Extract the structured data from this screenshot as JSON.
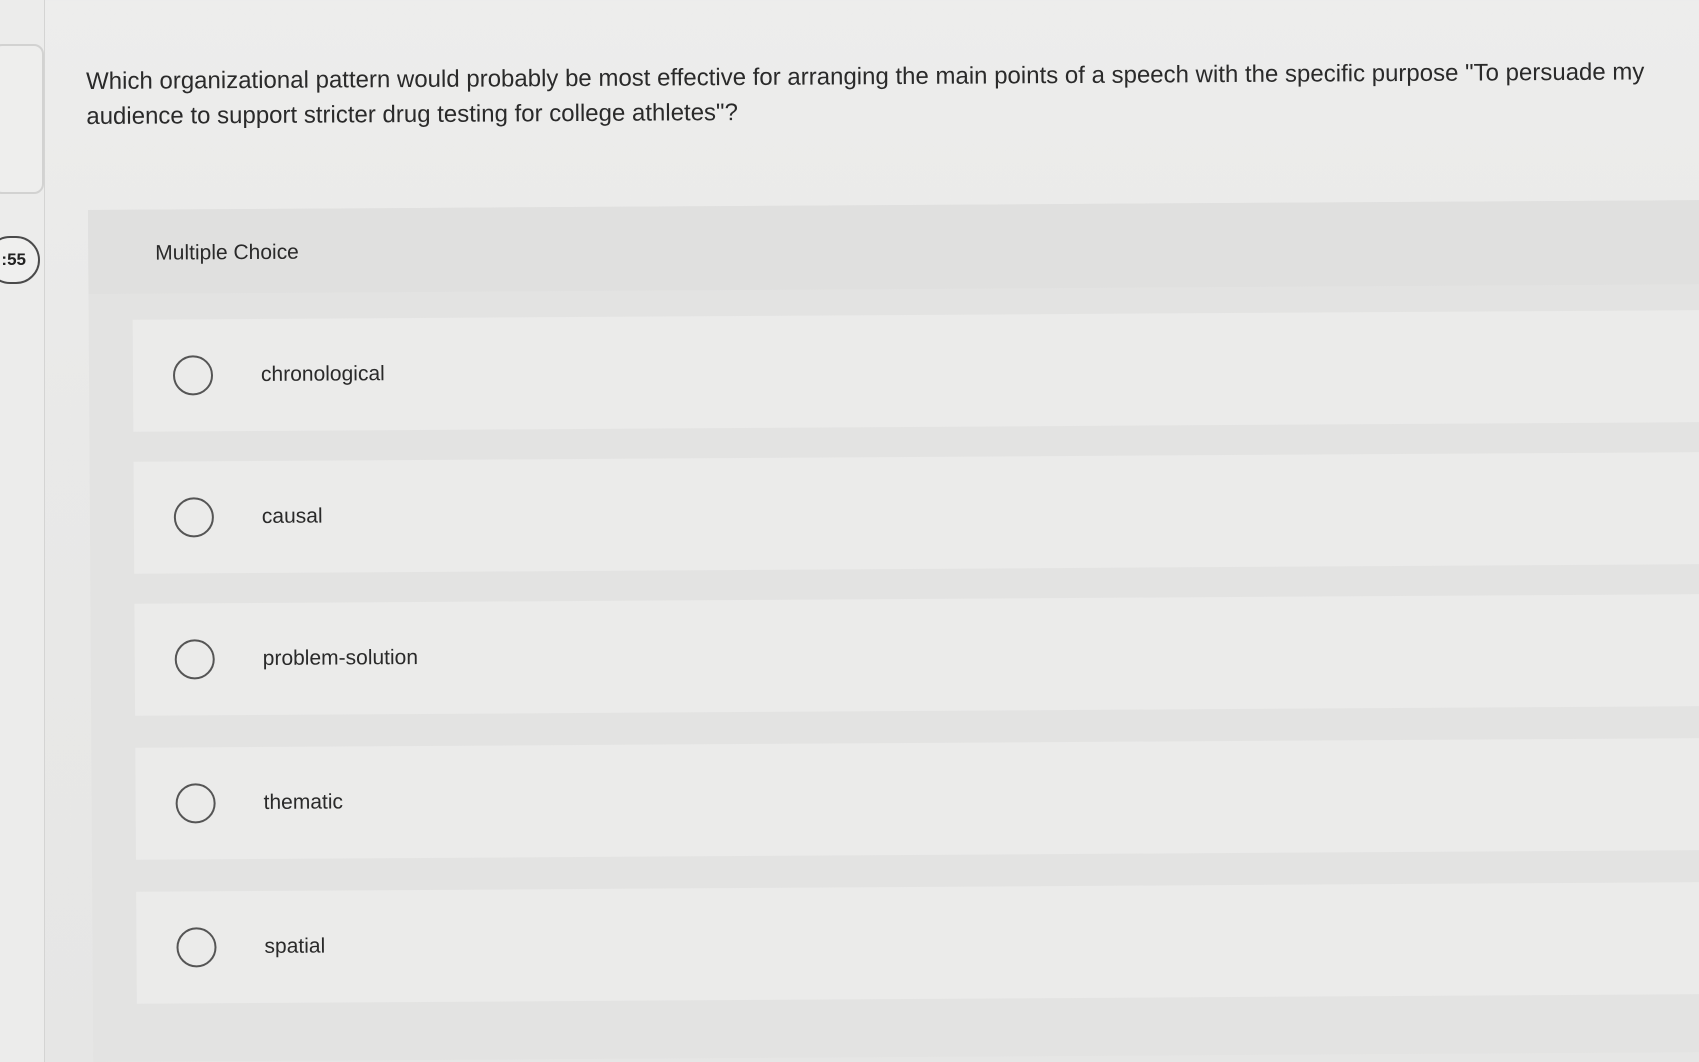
{
  "timer": {
    "text": ":55"
  },
  "question": {
    "text": "Which organizational pattern would probably be most effective for arranging the main points of a speech with the specific purpose \"To persuade my audience to support stricter drug testing for college athletes\"?"
  },
  "multiple_choice": {
    "label": "Multiple Choice",
    "options": [
      {
        "label": "chronological"
      },
      {
        "label": "causal"
      },
      {
        "label": "problem-solution"
      },
      {
        "label": "thematic"
      },
      {
        "label": "spatial"
      }
    ]
  }
}
